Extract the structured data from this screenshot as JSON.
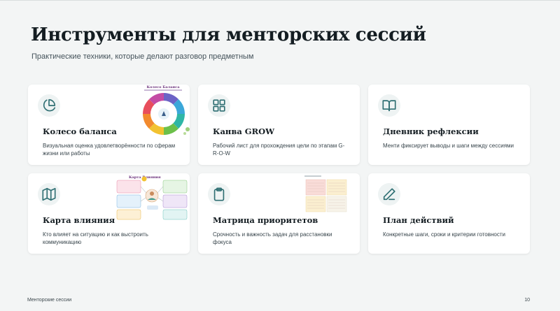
{
  "page": {
    "title": "Инструменты для менторских сессий",
    "subtitle": "Практические техники, которые делают разговор предметным"
  },
  "cards": [
    {
      "title": "Колесо баланса",
      "desc": "Визуальная оценка удовлетворённости по сферам жизни или работы",
      "icon": "pie-chart-icon",
      "thumb_title": "Колесо Баланса"
    },
    {
      "title": "Канва GROW",
      "desc": "Рабочий лист для прохождения цели по этапам G-R-O-W",
      "icon": "grid-icon"
    },
    {
      "title": "Дневник рефлексии",
      "desc": "Менти фиксирует выводы и шаги между сессиями",
      "icon": "book-icon"
    },
    {
      "title": "Карта влияния",
      "desc": "Кто влияет на ситуацию и как выстроить коммуникацию",
      "icon": "map-icon",
      "thumb_title": "Карта Влияния"
    },
    {
      "title": "Матрица приоритетов",
      "desc": "Срочность и важность задач для расстановки фокуса",
      "icon": "clipboard-icon"
    },
    {
      "title": "План действий",
      "desc": "Конкретные шаги, сроки и критерии готовности",
      "icon": "pen-icon"
    }
  ],
  "footer": {
    "left": "Менторские сессии",
    "page_number": "10"
  },
  "colors": {
    "accent": "#2f6f73",
    "background": "#f3f5f5",
    "card": "#ffffff"
  }
}
